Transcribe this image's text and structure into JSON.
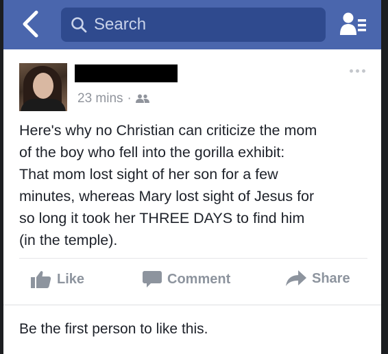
{
  "header": {
    "search_placeholder": "Search",
    "brand_color": "#4a66ad",
    "back_icon": "chevron-left-icon",
    "friends_icon": "friend-requests-icon"
  },
  "post": {
    "time": "23 mins",
    "separator": "·",
    "audience_icon": "friends-icon",
    "lines": [
      "Here's why no Christian can criticize the mom",
      "of the boy who fell into the gorilla exhibit:",
      "That mom lost sight of her son for a few",
      "minutes, whereas Mary lost sight of Jesus for",
      "so long it took her THREE DAYS to find him",
      "(in the temple)."
    ]
  },
  "actions": {
    "like": "Like",
    "comment": "Comment",
    "share": "Share"
  },
  "likes_summary": "Be the first person to like this."
}
